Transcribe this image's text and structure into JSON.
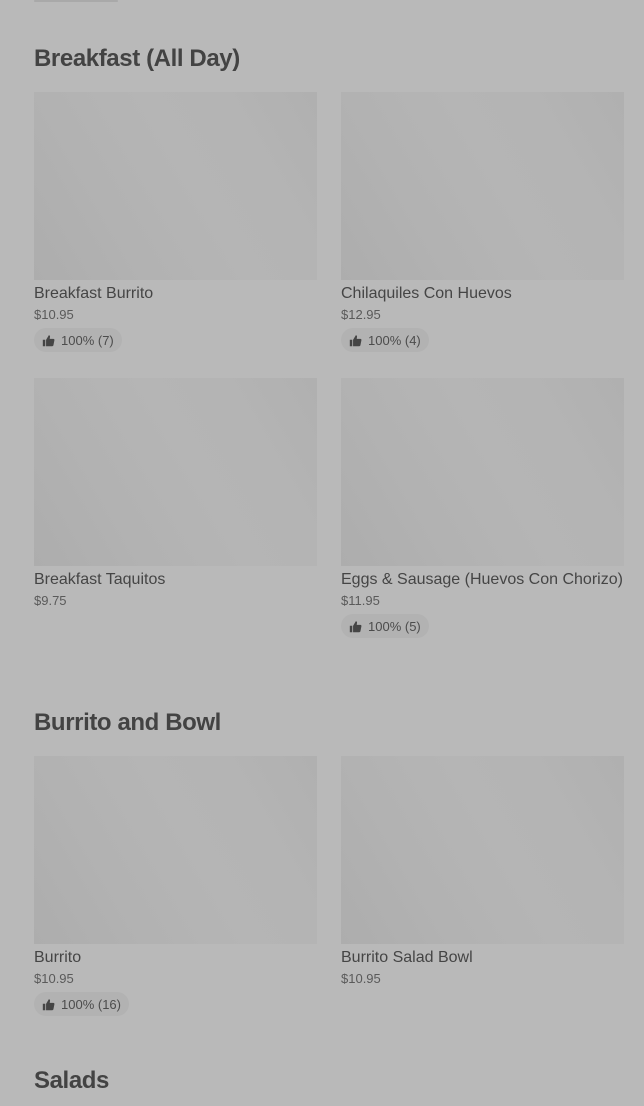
{
  "sections": [
    {
      "title": "Breakfast (All Day)",
      "items": [
        {
          "name": "Breakfast Burrito",
          "price": "$10.95",
          "rating": "100% (7)"
        },
        {
          "name": "Chilaquiles Con Huevos",
          "price": "$12.95",
          "rating": "100% (4)"
        },
        {
          "name": "Breakfast Taquitos",
          "price": "$9.75",
          "rating": null
        },
        {
          "name": "Eggs & Sausage (Huevos Con Chorizo)",
          "price": "$11.95",
          "rating": "100% (5)"
        }
      ]
    },
    {
      "title": "Burrito and Bowl",
      "items": [
        {
          "name": "Burrito",
          "price": "$10.95",
          "rating": "100% (16)"
        },
        {
          "name": "Burrito Salad Bowl",
          "price": "$10.95",
          "rating": null
        }
      ]
    },
    {
      "title": "Salads",
      "items": []
    }
  ],
  "icons": {
    "rating": "thumbs-up-icon"
  },
  "colors": {
    "background": "#b9b9b9",
    "badge": "#b2b2b2",
    "text": "#444444"
  }
}
